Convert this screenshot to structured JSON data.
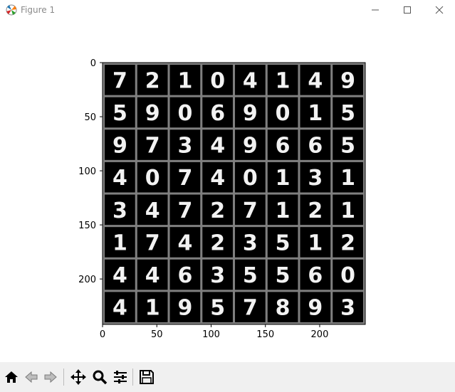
{
  "window": {
    "title": "Figure 1"
  },
  "colors": {
    "cell_background": "#000000",
    "grid_border": "#7f7f7f",
    "digit": "#f2f2f2"
  },
  "toolbar": {
    "buttons": [
      {
        "name": "home-icon"
      },
      {
        "name": "back-icon"
      },
      {
        "name": "forward-icon"
      },
      {
        "name": "pan-icon"
      },
      {
        "name": "zoom-icon"
      },
      {
        "name": "configure-subplots-icon"
      },
      {
        "name": "save-icon"
      }
    ]
  },
  "chart_data": {
    "type": "image",
    "xlim": [
      0,
      242
    ],
    "ylim": [
      242,
      0
    ],
    "xticks": [
      "0",
      "50",
      "100",
      "150",
      "200"
    ],
    "yticks": [
      "0",
      "50",
      "100",
      "150",
      "200"
    ],
    "grid_rows": 8,
    "grid_cols": 8,
    "digits": [
      [
        "7",
        "2",
        "1",
        "0",
        "4",
        "1",
        "4",
        "9"
      ],
      [
        "5",
        "9",
        "0",
        "6",
        "9",
        "0",
        "1",
        "5"
      ],
      [
        "9",
        "7",
        "3",
        "4",
        "9",
        "6",
        "6",
        "5"
      ],
      [
        "4",
        "0",
        "7",
        "4",
        "0",
        "1",
        "3",
        "1"
      ],
      [
        "3",
        "4",
        "7",
        "2",
        "7",
        "1",
        "2",
        "1"
      ],
      [
        "1",
        "7",
        "4",
        "2",
        "3",
        "5",
        "1",
        "2"
      ],
      [
        "4",
        "4",
        "6",
        "3",
        "5",
        "5",
        "6",
        "0"
      ],
      [
        "4",
        "1",
        "9",
        "5",
        "7",
        "8",
        "9",
        "3"
      ]
    ]
  }
}
